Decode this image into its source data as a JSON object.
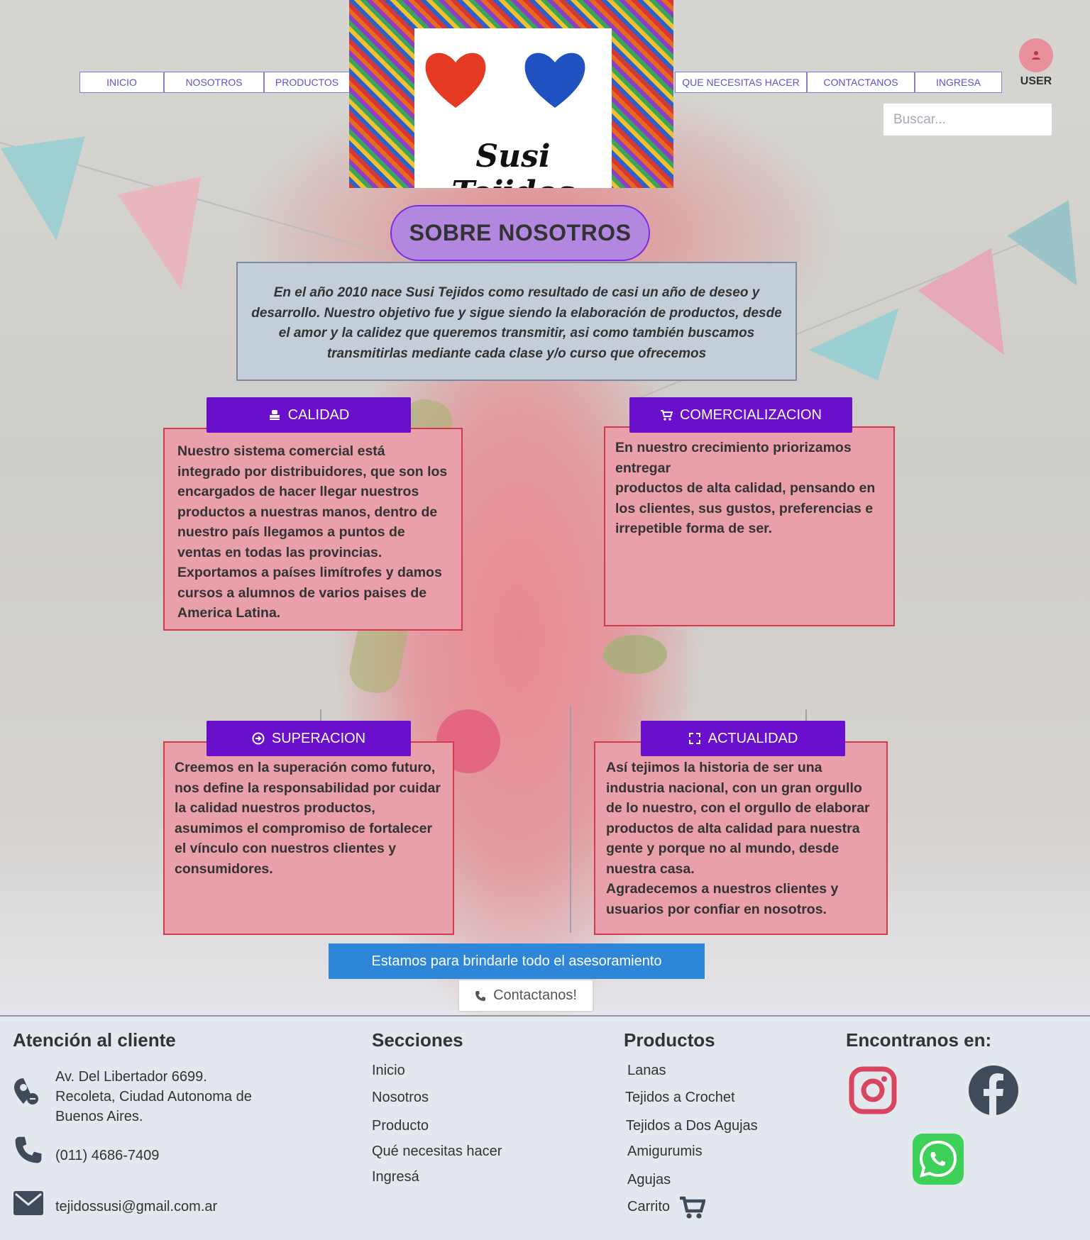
{
  "nav": {
    "left": [
      "INICIO",
      "NOSOTROS",
      "PRODUCTOS"
    ],
    "right": [
      "QUE NECESITAS HACER",
      "CONTACTANOS",
      "INGRESA"
    ]
  },
  "logo": {
    "text": "Susi Tejidos"
  },
  "user": {
    "label": "USER",
    "icon": "user-icon"
  },
  "search": {
    "placeholder": "Buscar..."
  },
  "page": {
    "title": "SOBRE NOSOTROS",
    "intro": "En el año 2010 nace Susi Tejidos como resultado de casi un año de deseo y desarrollo. Nuestro objetivo fue y sigue siendo la elaboración de productos, desde el amor y la calidez que queremos transmitir, asi como también buscamos transmitirlas mediante cada clase y/o curso que ofrecemos"
  },
  "sections": [
    {
      "key": "calidad",
      "label": "CALIDAD",
      "icon": "stamp-icon",
      "text": "Nuestro sistema comercial está integrado por distribuidores, que son los encargados de hacer llegar nuestros productos a nuestras manos, dentro de nuestro país llegamos a puntos de ventas en todas las provincias. Exportamos a países limítrofes y damos cursos a alumnos de varios paises de America Latina."
    },
    {
      "key": "comercializacion",
      "label": "COMERCIALIZACION",
      "icon": "cart-icon",
      "text": "En nuestro crecimiento priorizamos entregar\nproductos de alta calidad, pensando en los clientes, sus gustos, preferencias e\n irrepetible forma de ser."
    },
    {
      "key": "superacion",
      "label": "SUPERACION",
      "icon": "arrow-circle-icon",
      "text": "Creemos en la superación como futuro, nos define la responsabilidad por cuidar la calidad nuestros productos, asumimos el compromiso de fortalecer el vínculo con nuestros clientes y consumidores."
    },
    {
      "key": "actualidad",
      "label": "ACTUALIDAD",
      "icon": "expand-icon",
      "text": "Así tejimos la historia de ser una industria nacional, con un gran orgullo de lo nuestro, con el orgullo de elaborar productos de alta calidad para nuestra gente y porque no al mundo, desde nuestra casa.\nAgradecemos a nuestros clientes y usuarios por confiar en nosotros."
    }
  ],
  "cta": {
    "text": "Estamos para brindarle todo el asesoramiento",
    "contact": "Contactanos!"
  },
  "footer": {
    "atencion": {
      "heading": "Atención al cliente",
      "address": "Av. Del Libertador 6699.\nRecoleta, Ciudad Autonoma de\nBuenos Aires.",
      "phone": "(011) 4686-7409",
      "email": "tejidossusi@gmail.com.ar"
    },
    "secciones": {
      "heading": "Secciones",
      "items": [
        "Inicio",
        "Nosotros",
        "Producto",
        "Qué necesitas hacer",
        "Ingresá"
      ]
    },
    "productos": {
      "heading": "Productos",
      "items": [
        "Lanas",
        "Tejidos a Crochet",
        "Tejidos a Dos Agujas",
        "Amigurumis",
        "Agujas",
        "Carrito"
      ]
    },
    "encontranos": {
      "heading": "Encontranos en:",
      "icons": [
        "instagram-icon",
        "facebook-icon",
        "whatsapp-icon"
      ]
    }
  },
  "colors": {
    "tab": "#6a0fcc",
    "card": "#e9a0aa",
    "card_border": "#d33a4a",
    "title_pill": "#b287e0",
    "intro_bg": "#c4ced9",
    "cta": "#2e86d9",
    "footer_bg": "#e3e7ee"
  }
}
